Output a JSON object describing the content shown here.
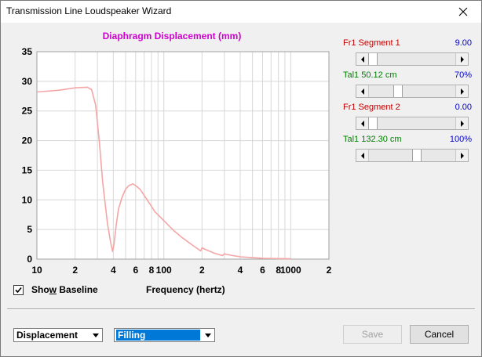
{
  "window": {
    "title": "Transmission Line Loudspeaker Wizard"
  },
  "chart_data": {
    "type": "line",
    "title": "Diaphragm Displacement (mm)",
    "xlabel": "Frequency (hertz)",
    "xscale": "log",
    "xlim": [
      10,
      2000
    ],
    "ylim": [
      0,
      35
    ],
    "yticks": [
      0,
      5,
      10,
      15,
      20,
      25,
      30,
      35
    ],
    "xtick_labels": [
      {
        "x": 10,
        "label": "10"
      },
      {
        "x": 20,
        "label": "2"
      },
      {
        "x": 40,
        "label": "4"
      },
      {
        "x": 60,
        "label": "6"
      },
      {
        "x": 80,
        "label": "8"
      },
      {
        "x": 100,
        "label": "100"
      },
      {
        "x": 200,
        "label": "2"
      },
      {
        "x": 400,
        "label": "4"
      },
      {
        "x": 600,
        "label": "6"
      },
      {
        "x": 800,
        "label": "8"
      },
      {
        "x": 1000,
        "label": "1000"
      },
      {
        "x": 2000,
        "label": "2"
      }
    ],
    "grid": true,
    "series": [
      {
        "color": "#f4a6a6",
        "x": [
          10,
          15,
          20,
          25,
          27,
          29,
          31,
          33,
          36,
          38,
          39.5,
          40.5,
          42,
          44,
          47,
          50,
          53,
          57,
          60,
          65,
          75,
          85,
          100,
          120,
          140,
          170,
          195,
          200,
          205,
          220,
          250,
          290,
          300,
          310,
          350,
          400,
          500,
          600,
          700,
          1000
        ],
        "y": [
          28.2,
          28.5,
          28.9,
          29.0,
          28.6,
          26.0,
          20.0,
          13.0,
          6.0,
          3.0,
          1.3,
          2.5,
          5.5,
          8.5,
          10.5,
          11.8,
          12.4,
          12.7,
          12.4,
          11.8,
          9.8,
          8.0,
          6.5,
          4.8,
          3.6,
          2.3,
          1.4,
          1.9,
          1.8,
          1.5,
          1.0,
          0.6,
          0.9,
          0.8,
          0.6,
          0.4,
          0.25,
          0.15,
          0.1,
          0.05
        ]
      }
    ]
  },
  "sliders": [
    {
      "label": "Fr1  Segment 1",
      "value": "9.00",
      "label_color": "#c00000",
      "fraction": 0.0
    },
    {
      "label": "Tal1  50.12 cm",
      "value": "70%",
      "label_color": "#008000",
      "fraction": 0.32
    },
    {
      "label": "Fr1  Segment 2",
      "value": "0.00",
      "label_color": "#c00000",
      "fraction": 0.0
    },
    {
      "label": "Tal1  132.30 cm",
      "value": "100%",
      "label_color": "#008000",
      "fraction": 0.56
    }
  ],
  "baseline": {
    "pre": "Sho",
    "accel": "w",
    "post": " Baseline",
    "checked": true
  },
  "frequency_label": "Frequency (hertz)",
  "dropdowns": {
    "plot_type": "Displacement",
    "section": "Filling"
  },
  "buttons": {
    "save": "Save",
    "cancel": "Cancel"
  }
}
